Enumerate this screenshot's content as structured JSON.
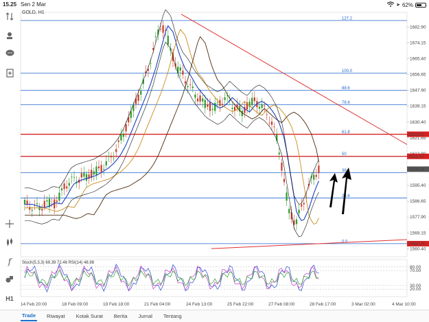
{
  "status_bar": {
    "time": "15.25",
    "date": "Sen 2 Mar",
    "battery": "62%",
    "battery_level": 0.62,
    "wifi_icon": "wifi-icon"
  },
  "chart": {
    "symbol": "GOLD, H1",
    "price_ticks": [
      "1682.90",
      "1674.15",
      "1665.40",
      "1656.65",
      "1647.90",
      "1639.15",
      "1630.40",
      "1621.65",
      "1612.90",
      "1604.15",
      "1595.40",
      "1586.65",
      "1577.90",
      "1569.15",
      "1560.40"
    ],
    "price_tick_values": [
      1682.9,
      1674.15,
      1665.4,
      1656.65,
      1647.9,
      1639.15,
      1630.4,
      1621.65,
      1612.9,
      1604.15,
      1595.4,
      1586.65,
      1577.9,
      1569.15,
      1560.4
    ],
    "price_range": [
      1556.0,
      1691.0
    ],
    "time_ticks": [
      "14 Feb 20:00",
      "18 Feb 09:00",
      "19 Feb 18:00",
      "21 Feb 04:00",
      "24 Feb 13:00",
      "25 Feb 22:00",
      "27 Feb 08:00",
      "28 Feb 17:00",
      "3 Mar 02:00",
      "4 Mar 10:00"
    ],
    "price_markers": [
      {
        "label": "1623.67",
        "price": 1623.67,
        "color": "#d62020"
      },
      {
        "label": "1611.47",
        "price": 1611.47,
        "color": "#d62020"
      },
      {
        "label": "1604.38",
        "price": 1604.38,
        "color": "#555555"
      },
      {
        "label": "1563.24",
        "price": 1563.24,
        "color": "#d62020"
      }
    ],
    "fib_levels": [
      {
        "label": "127.2",
        "price": 1686.5
      },
      {
        "label": "100.0",
        "price": 1657.5
      },
      {
        "label": "88.6",
        "price": 1648.0
      },
      {
        "label": "78.6",
        "price": 1640.0
      },
      {
        "label": "61.8",
        "price": 1623.67
      },
      {
        "label": "50",
        "price": 1611.47
      },
      {
        "label": "38",
        "price": 1602.5
      },
      {
        "label": "23.6",
        "price": 1588.5
      },
      {
        "label": "0.0",
        "price": 1563.24
      }
    ],
    "indicator_label": "Stoch(5,3,3) 69.39 72.46 RSI(14) 48.98",
    "indicator_ticks": [
      "80.00",
      "70.00",
      "30.00",
      "20.00"
    ],
    "colors": {
      "fib": "#2266cc",
      "resistance": "#d62020",
      "trendline": "#e03030",
      "ma_fast": "#1a3fbf",
      "ma_mid": "#c98a1a",
      "ma_slow": "#4a2a0a",
      "bollinger": "#111111",
      "bull": "#2a9a2a",
      "bear": "#c83a2a"
    }
  },
  "tool_icons": [
    "arrows-icon",
    "trade-icon",
    "chat-icon",
    "document-icon",
    "crosshair-icon",
    "candle-icon",
    "function-icon",
    "shapes-icon",
    "timeframe-icon"
  ],
  "tool_labels": {
    "timeframe": "H1"
  },
  "tabs": [
    {
      "label": "Trade",
      "active": true
    },
    {
      "label": "Riwayat",
      "active": false
    },
    {
      "label": "Kotak Surat",
      "active": false
    },
    {
      "label": "Berita",
      "active": false
    },
    {
      "label": "Jurnal",
      "active": false
    },
    {
      "label": "Tentang",
      "active": false
    }
  ]
}
